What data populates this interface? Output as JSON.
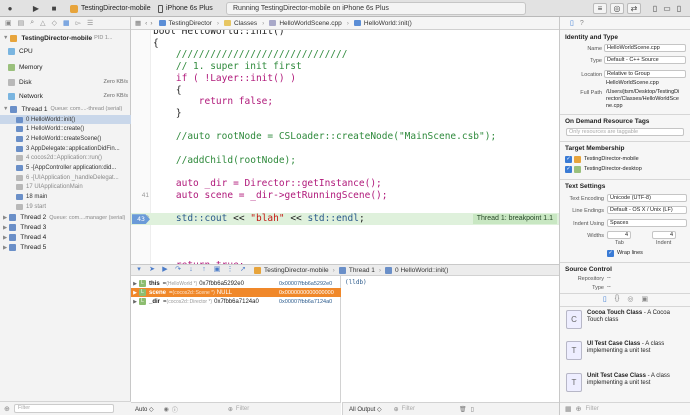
{
  "toolbar": {
    "scheme_name": "TestingDirector-mobile",
    "device": "iPhone 6s Plus",
    "status_text": "Running TestingDirector-mobile on iPhone 6s Plus"
  },
  "navigator": {
    "process": {
      "name": "TestingDirector-mobile",
      "pid": "PID 1..."
    },
    "gauges": [
      {
        "label": "CPU",
        "value": ""
      },
      {
        "label": "Memory",
        "value": ""
      },
      {
        "label": "Disk",
        "value": "Zero KB/s"
      },
      {
        "label": "Network",
        "value": "Zero KB/s"
      }
    ],
    "thread1": {
      "label": "Thread 1",
      "queue": "Queue: com....-thread (serial)"
    },
    "frames": [
      {
        "label": "0 HelloWorld::init()",
        "selected": true,
        "dim": false
      },
      {
        "label": "1 HelloWorld::create()",
        "selected": false,
        "dim": false
      },
      {
        "label": "2 HelloWorld::createScene()",
        "selected": false,
        "dim": false
      },
      {
        "label": "3 AppDelegate::applicationDidFin...",
        "selected": false,
        "dim": false
      },
      {
        "label": "4 cocos2d::Application::run()",
        "selected": false,
        "dim": true
      },
      {
        "label": "5 -[AppController application:did...",
        "selected": false,
        "dim": false
      },
      {
        "label": "6 -[UIApplication _handleDelegat...",
        "selected": false,
        "dim": true
      },
      {
        "label": "17 UIApplicationMain",
        "selected": false,
        "dim": true
      },
      {
        "label": "18 main",
        "selected": false,
        "dim": false
      },
      {
        "label": "19 start",
        "selected": false,
        "dim": true
      }
    ],
    "thread2": {
      "label": "Thread 2",
      "queue": "Queue: com....manager (serial)"
    },
    "threads": [
      "Thread 3",
      "Thread 4",
      "Thread 5"
    ],
    "filter_placeholder": "Filter"
  },
  "jumpbar": {
    "crumbs": [
      "TestingDirector",
      "Classes",
      "HelloWorldScene.cpp",
      "HelloWorld::init()"
    ]
  },
  "editor": {
    "lines": [
      {
        "num": "",
        "code": "bool HelloWorld::init()",
        "cls": ""
      },
      {
        "num": "",
        "code": "{",
        "cls": ""
      },
      {
        "num": "",
        "code": "    //////////////////////////////",
        "cls": "cm"
      },
      {
        "num": "",
        "code": "    // 1. super init first",
        "cls": "cm"
      },
      {
        "num": "",
        "code": "    if ( !Layer::init() )",
        "cls": "kw"
      },
      {
        "num": "",
        "code": "    {",
        "cls": ""
      },
      {
        "num": "",
        "code": "        return false;",
        "cls": "kw"
      },
      {
        "num": "",
        "code": "    }",
        "cls": ""
      },
      {
        "num": "",
        "code": "",
        "cls": ""
      },
      {
        "num": "",
        "code": "    //auto rootNode = CSLoader::createNode(\"MainScene.csb\");",
        "cls": "cm"
      },
      {
        "num": "",
        "code": "",
        "cls": ""
      },
      {
        "num": "",
        "code": "    //addChild(rootNode);",
        "cls": "cm"
      },
      {
        "num": "",
        "code": "",
        "cls": ""
      },
      {
        "num": "",
        "code": "    auto _dir = Director::getInstance();",
        "cls": "kw"
      },
      {
        "num": "41",
        "code": "    auto scene = _dir->getRunningScene();",
        "cls": "kw"
      },
      {
        "num": "",
        "code": "",
        "cls": ""
      },
      {
        "num": "43",
        "code": "    std::cout << \"blah\" << std::endl;",
        "cls": "hl"
      },
      {
        "num": "",
        "code": "",
        "cls": ""
      },
      {
        "num": "",
        "code": "",
        "cls": ""
      },
      {
        "num": "",
        "code": "",
        "cls": ""
      },
      {
        "num": "",
        "code": "    return true;",
        "cls": "kw"
      },
      {
        "num": "",
        "code": "}",
        "cls": ""
      }
    ],
    "breakpoint_label": "Thread 1: breakpoint 1.1",
    "breakpoint_line": "43"
  },
  "debugbar": {
    "target": "TestingDirector-mobile",
    "thread": "Thread 1",
    "frame": "0 HelloWorld::init()"
  },
  "variables": [
    {
      "name": "this",
      "type": "(HelloWorld *)",
      "value": "0x7fbb6a5292e0",
      "addr": "0x00007fbb6a5292e0",
      "selected": false
    },
    {
      "name": "scene",
      "type": "(cocos2d::Scene *)",
      "value": "NULL",
      "addr": "0x0000000000000000",
      "selected": true
    },
    {
      "name": "_dir",
      "type": "(cocos2d::Director *)",
      "value": "0x7fbb6a7124a0",
      "addr": "0x00007fbb6a7124a0",
      "selected": false
    }
  ],
  "console": {
    "prompt": "(lldb)"
  },
  "bottom": {
    "auto_label": "Auto",
    "filter_placeholder": "Filter",
    "output_label": "All Output"
  },
  "inspector": {
    "identity_title": "Identity and Type",
    "name_label": "Name",
    "name_value": "HelloWorldScene.cpp",
    "type_label": "Type",
    "type_value": "Default - C++ Source",
    "location_label": "Location",
    "location_value": "Relative to Group",
    "location_file": "HelloWorldScene.cpp",
    "fullpath_label": "Full Path",
    "fullpath_value": "/Users/jtsm/Desktop/TestingDirector/Classes/HelloWorldScene.cpp",
    "odr_title": "On Demand Resource Tags",
    "odr_placeholder": "Only resources are taggable",
    "membership_title": "Target Membership",
    "targets": [
      "TestingDirector-mobile",
      "TestingDirector-desktop"
    ],
    "text_title": "Text Settings",
    "encoding_label": "Text Encoding",
    "encoding_value": "Unicode (UTF-8)",
    "endings_label": "Line Endings",
    "endings_value": "Default - OS X / Unix (LF)",
    "indent_label": "Indent Using",
    "indent_value": "Spaces",
    "widths_label": "Widths",
    "tab_width": "4",
    "indent_width": "4",
    "tab_caption": "Tab",
    "indent_caption": "Indent",
    "wrap_label": "Wrap lines",
    "sc_title": "Source Control",
    "repo_label": "Repository",
    "repo_value": "--",
    "sc_type_label": "Type",
    "sc_type_value": "--",
    "library": [
      {
        "title": "Cocoa Touch Class",
        "desc": " - A Cocoa Touch class",
        "icon": "C"
      },
      {
        "title": "UI Test Case Class",
        "desc": " - A class implementing a unit test",
        "icon": "T"
      },
      {
        "title": "Unit Test Case Class",
        "desc": " - A class implementing a unit test",
        "icon": "T"
      }
    ],
    "lib_filter_placeholder": "Filter"
  }
}
